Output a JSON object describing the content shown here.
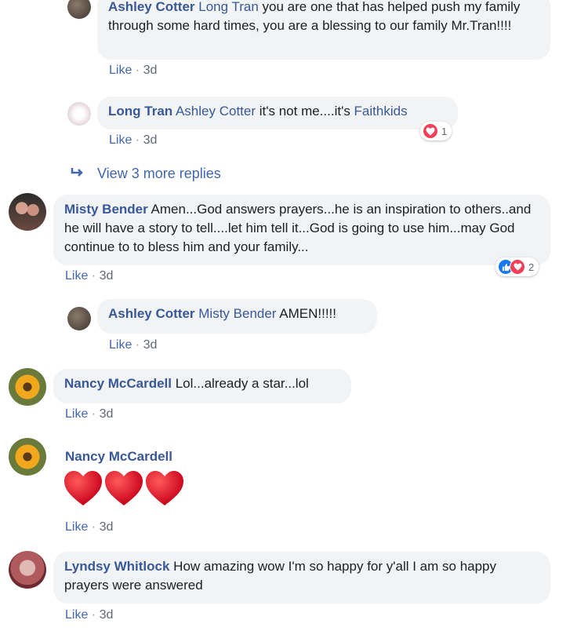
{
  "comments": [
    {
      "author": "Ashley Cotter",
      "mention": "Long Tran",
      "text": " you are one that has helped push my family through some hard times, you are a blessing to our family Mr.Tran!!!!",
      "like_label": "Like",
      "separator": " · ",
      "time": "3d"
    },
    {
      "author": "Long Tran",
      "mention": "Ashley Cotter",
      "text": " it's not me....it's ",
      "link": "Faithkids",
      "like_label": "Like",
      "separator": " · ",
      "time": "3d",
      "reaction_count": "1"
    },
    {
      "author": "Misty Bender",
      "text": " Amen...God answers prayers...he is an inspiration to others..and he will have a story to tell....let him tell it...God is going to use him...may God continue to to bless him and your family...",
      "like_label": "Like",
      "separator": " · ",
      "time": "3d",
      "reaction_count": "2"
    },
    {
      "author": "Ashley Cotter",
      "mention": "Misty Bender",
      "text": " AMEN!!!!!",
      "like_label": "Like",
      "separator": " · ",
      "time": "3d"
    },
    {
      "author": "Nancy McCardell",
      "text": " Lol...already a star...lol",
      "like_label": "Like",
      "separator": " · ",
      "time": "3d"
    },
    {
      "author": "Nancy McCardell",
      "emoji": "❤❤❤",
      "like_label": "Like",
      "separator": " · ",
      "time": "3d"
    },
    {
      "author": "Lyndsy Whitlock",
      "text": " How amazing wow I'm so happy for y'all I am so happy prayers were answered",
      "like_label": "Like",
      "separator": " · ",
      "time": "3d"
    }
  ],
  "view_more": "View 3 more replies",
  "colors": {
    "author": "#385898",
    "bubble": "#f2f3f5",
    "like": "#4267b2",
    "love": "#f33e58",
    "like_reaction": "#1877f2"
  }
}
